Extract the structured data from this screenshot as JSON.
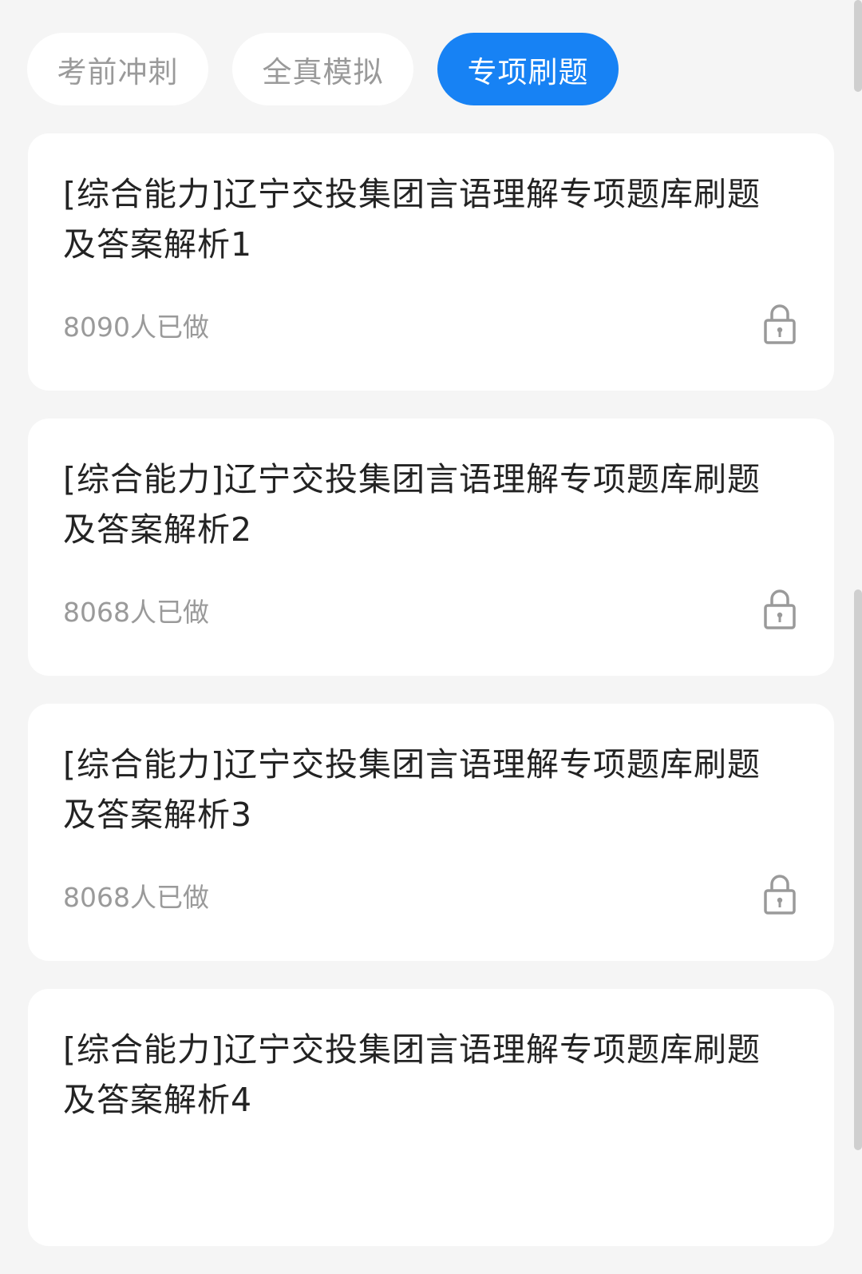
{
  "tabs": [
    {
      "label": "考前冲刺",
      "active": false
    },
    {
      "label": "全真模拟",
      "active": false
    },
    {
      "label": "专项刷题",
      "active": true
    }
  ],
  "items": [
    {
      "title": "[综合能力]辽宁交投集团言语理解专项题库刷题及答案解析1",
      "count": "8090人已做",
      "icon": "lock-icon"
    },
    {
      "title": "[综合能力]辽宁交投集团言语理解专项题库刷题及答案解析2",
      "count": "8068人已做",
      "icon": "lock-icon"
    },
    {
      "title": "[综合能力]辽宁交投集团言语理解专项题库刷题及答案解析3",
      "count": "8068人已做",
      "icon": "lock-icon"
    },
    {
      "title": "[综合能力]辽宁交投集团言语理解专项题库刷题及答案解析4",
      "count": "",
      "icon": "lock-icon"
    }
  ],
  "colors": {
    "accent": "#1782f4",
    "background": "#f5f5f5",
    "card": "#ffffff",
    "title_text": "#232323",
    "muted_text": "#9a9a9a"
  }
}
